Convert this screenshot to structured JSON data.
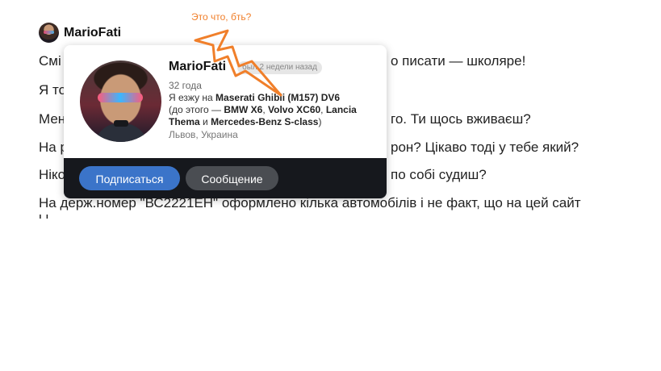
{
  "comment": {
    "author": "MarioFati",
    "lines": [
      {
        "left": "Смі",
        "right": "о писати — школяре!"
      },
      {
        "left": "Я то"
      },
      {
        "left": "Мен",
        "right": "го. Ти щось вживаєш?"
      },
      {
        "left": "На р",
        "right": "рон? Цікаво тоді у тебе який?"
      },
      {
        "left": "Ніко",
        "right": "по собі судиш?"
      },
      {
        "left": "На держ.номер \"ВС2221ЕН\" оформлено кілька автомобілів і не факт, що на цей сайт"
      }
    ],
    "partial_line": "        і                    і"
  },
  "popup": {
    "name": "MarioFati",
    "badge": "был 2 недели назад",
    "age": "32 года",
    "cars_prefix": "Я езжу на ",
    "main_car": "Maserati Ghibli (M157) DV6",
    "before_prefix": "(до этого — ",
    "car1": "BMW X6",
    "sep1": ", ",
    "car2": "Volvo XC60",
    "sep2": ", ",
    "car3": "Lancia Thema",
    "and": " и ",
    "car4": "Mercedes-Benz S-class",
    "suffix": ")",
    "city": "Львов, Украина",
    "subscribe_label": "Подписаться",
    "message_label": "Сообщение"
  },
  "annotation": {
    "text": "Это что, бть?",
    "color": "#f07f2a"
  },
  "colors": {
    "subscribe_button": "#3b74c9",
    "message_button": "#4a4d52",
    "popup_footer": "#16181d"
  }
}
